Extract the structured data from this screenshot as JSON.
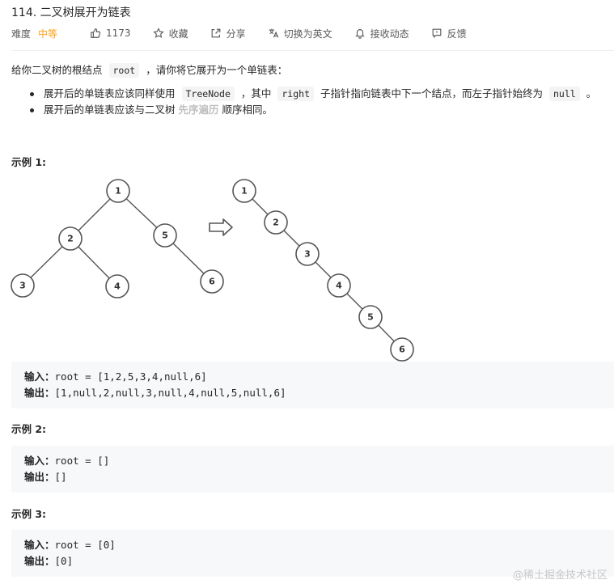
{
  "problem": {
    "title": "114. 二叉树展开为链表"
  },
  "meta": {
    "difficulty_label": "难度",
    "difficulty_value": "中等",
    "likes": "1173",
    "favorite": "收藏",
    "share": "分享",
    "switch_lang": "切换为英文",
    "notify": "接收动态",
    "feedback": "反馈"
  },
  "description": {
    "intro_before": "给你二叉树的根结点",
    "intro_code": "root",
    "intro_after": "，请你将它展开为一个单链表：",
    "bullet1": {
      "t1": "展开后的单链表应该同样使用",
      "c1": "TreeNode",
      "t2": "，其中",
      "c2": "right",
      "t3": "子指针指向链表中下一个结点，而左子指针始终为",
      "c3": "null",
      "t4": "。"
    },
    "bullet2": {
      "t1": "展开后的单链表应该与二叉树",
      "bold": "先序遍历",
      "t2": "顺序相同。"
    }
  },
  "examples": [
    {
      "title": "示例 1:",
      "input_label": "输入：",
      "input": "root = [1,2,5,3,4,null,6]",
      "output_label": "输出：",
      "output": "[1,null,2,null,3,null,4,null,5,null,6]"
    },
    {
      "title": "示例 2:",
      "input_label": "输入：",
      "input": "root = []",
      "output_label": "输出：",
      "output": "[]"
    },
    {
      "title": "示例 3:",
      "input_label": "输入：",
      "input": "root = [0]",
      "output_label": "输出：",
      "output": "[0]"
    }
  ],
  "figure": {
    "tree_nodes": [
      "1",
      "2",
      "5",
      "3",
      "4",
      "6"
    ],
    "list_nodes": [
      "1",
      "2",
      "3",
      "4",
      "5",
      "6"
    ]
  },
  "watermark": "@稀土掘金技术社区",
  "colors": {
    "accent": "#ffa116",
    "code_bg": "#f7f8fa",
    "text": "#262626"
  }
}
